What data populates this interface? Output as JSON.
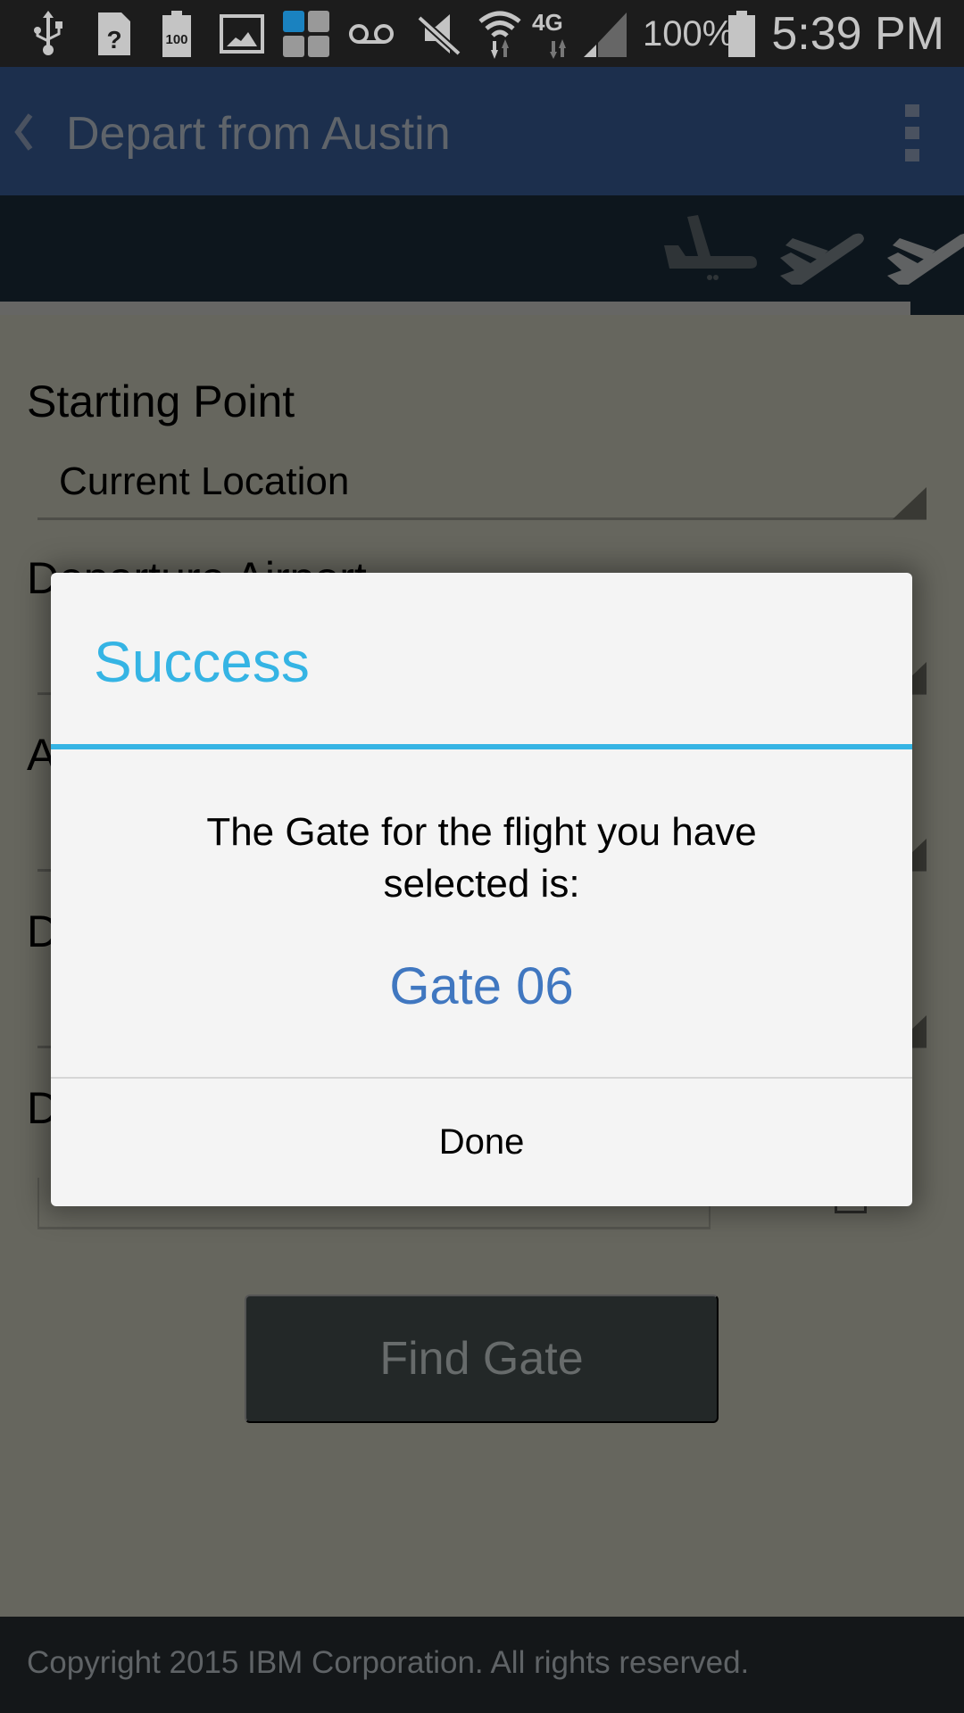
{
  "status_bar": {
    "icons": [
      "usb-icon",
      "sim-unknown-icon",
      "battery-100-notification-icon",
      "image-icon",
      "app-grid-icon",
      "voicemail-icon",
      "mute-icon",
      "wifi-icon",
      "4g-lte-icon",
      "signal-icon",
      "battery-icon"
    ],
    "battery_percent": "100%",
    "time": "5:39 PM",
    "battery_badge": "100",
    "network_label": "4G"
  },
  "app_bar": {
    "back_glyph": "‹",
    "title": "Depart from Austin"
  },
  "header_icons": [
    "plane-landing-icon",
    "plane-takeoff-icon",
    "plane-takeoff-icon"
  ],
  "form": {
    "fields": [
      {
        "label": "Starting Point",
        "value": "Current Location"
      },
      {
        "label": "Departure Airport",
        "value": ""
      },
      {
        "label": "A",
        "value": ""
      },
      {
        "label": "D",
        "value": ""
      },
      {
        "label": "D",
        "value": ""
      }
    ],
    "find_gate_label": "Find Gate"
  },
  "dialog": {
    "title": "Success",
    "message": "The Gate for the flight you have selected is:",
    "gate": "Gate 06",
    "done_label": "Done"
  },
  "footer": {
    "copyright": "Copyright 2015 IBM Corporation. All rights reserved."
  },
  "colors": {
    "accent": "#35b4e4",
    "gate_text": "#4077c0",
    "app_bar": "#1c2f4d",
    "footer": "#141719"
  }
}
